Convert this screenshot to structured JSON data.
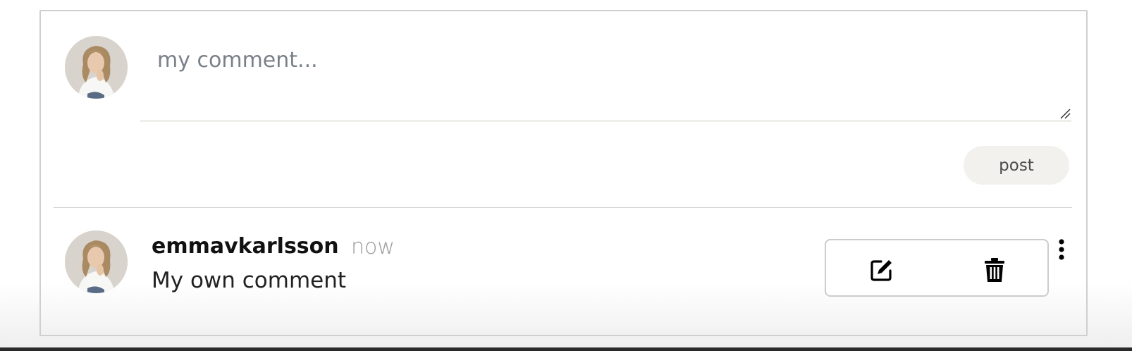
{
  "composer": {
    "avatar_alt": "user avatar",
    "input_value": "",
    "input_placeholder": "my comment...",
    "post_label": "post"
  },
  "comments": [
    {
      "username": "emmavkarlsson",
      "time": "now",
      "text": "My own comment",
      "actions": {
        "edit_icon": "edit-icon",
        "delete_icon": "trash-icon",
        "more_icon": "more-vertical-icon"
      }
    }
  ],
  "colors": {
    "post_button_bg": "#f2f1ee",
    "text_primary": "#111111",
    "text_muted": "#9a9a9a"
  }
}
